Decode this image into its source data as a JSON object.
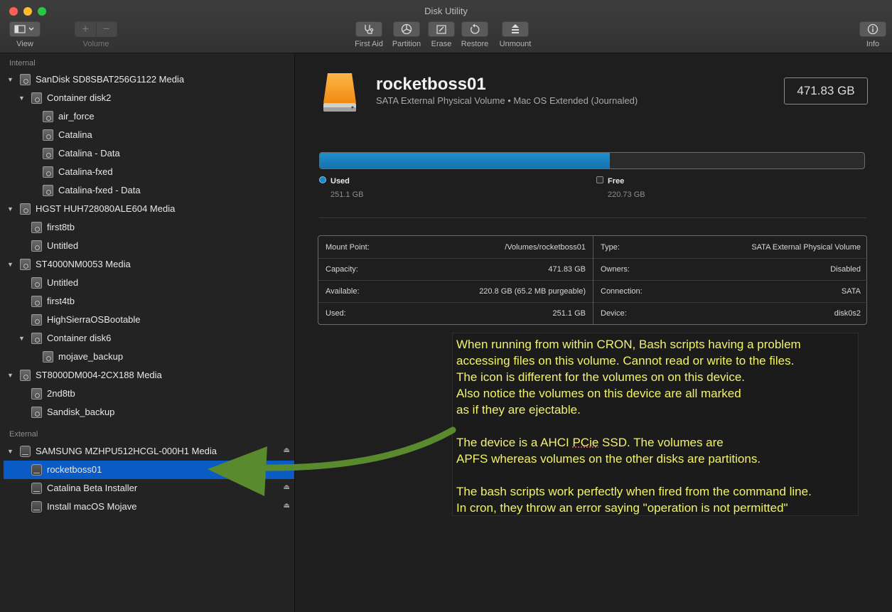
{
  "window": {
    "title": "Disk Utility"
  },
  "toolbar": {
    "view": "View",
    "volume": "Volume",
    "first_aid": "First Aid",
    "partition": "Partition",
    "erase": "Erase",
    "restore": "Restore",
    "unmount": "Unmount",
    "info": "Info"
  },
  "sidebar": {
    "internal_label": "Internal",
    "external_label": "External",
    "items": [
      "SanDisk SD8SBAT256G1122 Media",
      "Container disk2",
      "air_force",
      "Catalina",
      "Catalina - Data",
      "Catalina-fxed",
      "Catalina-fxed - Data",
      "HGST HUH728080ALE604 Media",
      "first8tb",
      "Untitled",
      "ST4000NM0053 Media",
      "Untitled",
      "first4tb",
      "HighSierraOSBootable",
      "Container disk6",
      "mojave_backup",
      "ST8000DM004-2CX188 Media",
      "2nd8tb",
      "Sandisk_backup",
      "SAMSUNG MZHPU512HCGL-000H1 Media",
      "rocketboss01",
      "Catalina Beta Installer",
      "Install macOS Mojave"
    ]
  },
  "volume": {
    "name": "rocketboss01",
    "subtitle": "SATA External Physical Volume • Mac OS Extended (Journaled)",
    "capacity": "471.83 GB",
    "used_fraction": 0.532,
    "used_label": "Used",
    "used_value": "251.1 GB",
    "free_label": "Free",
    "free_value": "220.73 GB",
    "used_color": "#1b87c9"
  },
  "info": {
    "left": [
      {
        "k": "Mount Point:",
        "v": "/Volumes/rocketboss01"
      },
      {
        "k": "Capacity:",
        "v": "471.83 GB"
      },
      {
        "k": "Available:",
        "v": "220.8 GB (65.2 MB purgeable)"
      },
      {
        "k": "Used:",
        "v": "251.1 GB"
      }
    ],
    "right": [
      {
        "k": "Type:",
        "v": "SATA External Physical Volume"
      },
      {
        "k": "Owners:",
        "v": "Disabled"
      },
      {
        "k": "Connection:",
        "v": "SATA"
      },
      {
        "k": "Device:",
        "v": "disk0s2"
      }
    ]
  },
  "annotation": {
    "l1": "When running from within CRON, Bash scripts having a problem",
    "l2": "accessing files on this volume. Cannot read or write to the files.",
    "l3": "The icon is different for the volumes on on this device.",
    "l4": "Also notice the volumes on this device are all marked",
    "l5": "as if they are ejectable.",
    "l6a": "The device is a AHCI ",
    "l6b": "PCie",
    "l6c": " SSD.  The volumes are",
    "l7": "APFS whereas volumes on the other disks are partitions.",
    "l8": "The bash scripts work perfectly when fired from the command line.",
    "l9": "In cron, they throw an error saying \"operation is not permitted\"",
    "arrow_color": "#5a8a2e"
  }
}
